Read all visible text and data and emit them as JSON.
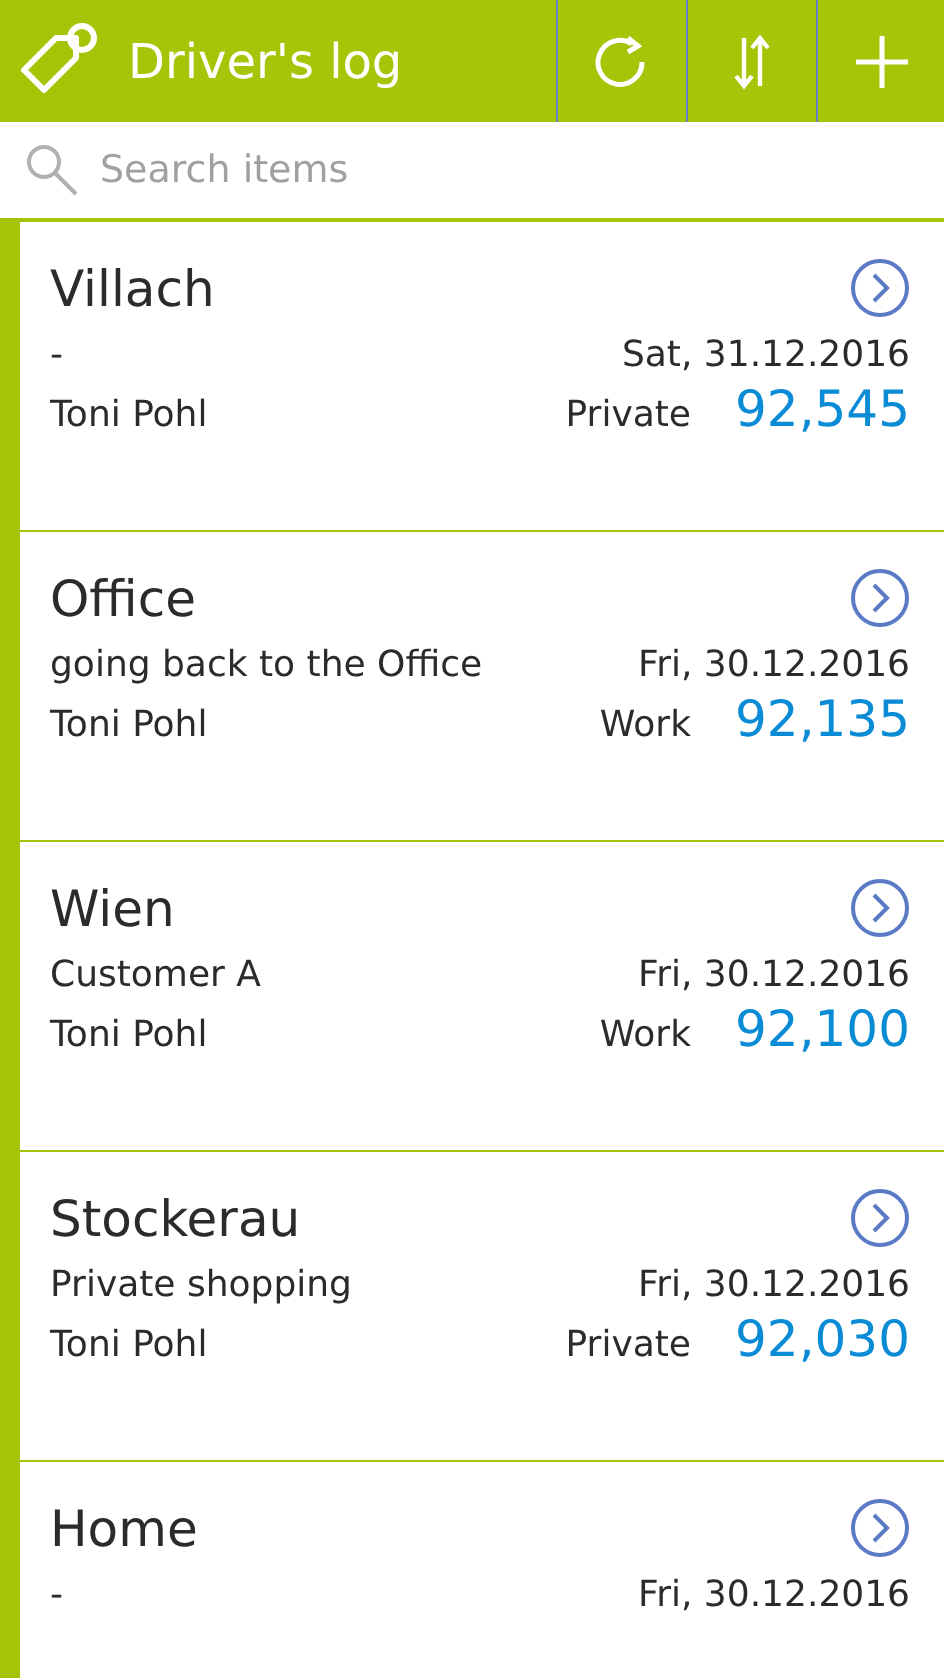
{
  "header": {
    "title": "Driver's log"
  },
  "search": {
    "placeholder": "Search items"
  },
  "entries": [
    {
      "destination": "Villach",
      "note": "-",
      "date": "Sat, 31.12.2016",
      "driver": "Toni Pohl",
      "category": "Private",
      "odometer": "92,545"
    },
    {
      "destination": "Office",
      "note": "going back to the Office",
      "date": "Fri, 30.12.2016",
      "driver": "Toni Pohl",
      "category": "Work",
      "odometer": "92,135"
    },
    {
      "destination": "Wien",
      "note": "Customer A",
      "date": "Fri, 30.12.2016",
      "driver": "Toni Pohl",
      "category": "Work",
      "odometer": "92,100"
    },
    {
      "destination": "Stockerau",
      "note": "Private shopping",
      "date": "Fri, 30.12.2016",
      "driver": "Toni Pohl",
      "category": "Private",
      "odometer": "92,030"
    },
    {
      "destination": "Home",
      "note": "-",
      "date": "Fri, 30.12.2016"
    }
  ]
}
